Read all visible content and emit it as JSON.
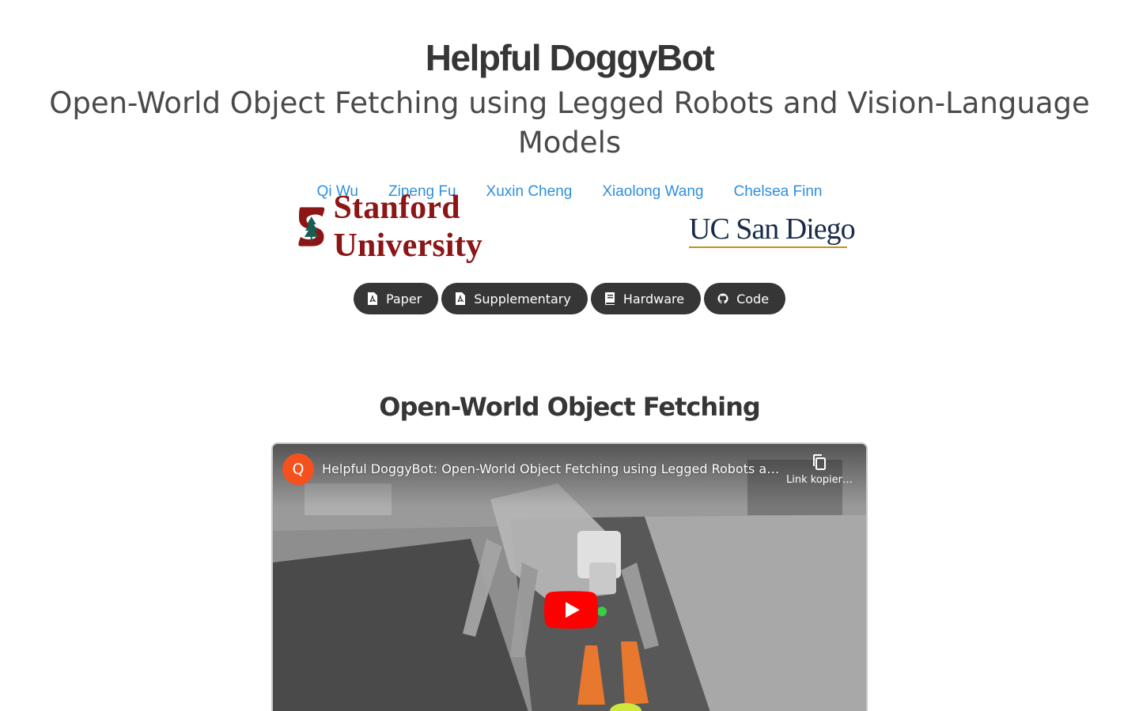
{
  "header": {
    "title": "Helpful DoggyBot",
    "subtitle": "Open-World Object Fetching using Legged Robots and Vision-Language Models"
  },
  "authors": [
    "Qi Wu",
    "Zipeng Fu",
    "Xuxin Cheng",
    "Xiaolong Wang",
    "Chelsea Finn"
  ],
  "affiliations": {
    "stanford": "Stanford University",
    "ucsd": "UC San Diego"
  },
  "links": [
    {
      "label": "Paper",
      "icon": "pdf-icon"
    },
    {
      "label": "Supplementary",
      "icon": "pdf-icon"
    },
    {
      "label": "Hardware",
      "icon": "book-icon"
    },
    {
      "label": "Code",
      "icon": "github-icon"
    }
  ],
  "section": {
    "title": "Open-World Object Fetching"
  },
  "video": {
    "channel_initial": "Q",
    "title": "Helpful DoggyBot: Open-World Object Fetching using Legged Robots a…",
    "copy_link_label": "Link kopier…"
  },
  "colors": {
    "link": "#2d8fe0",
    "button_bg": "#363636",
    "stanford": "#8c1515",
    "ucsd_navy": "#182b49",
    "ucsd_gold": "#c69214",
    "youtube_red": "#ff0000",
    "channel_avatar": "#f4511e"
  }
}
